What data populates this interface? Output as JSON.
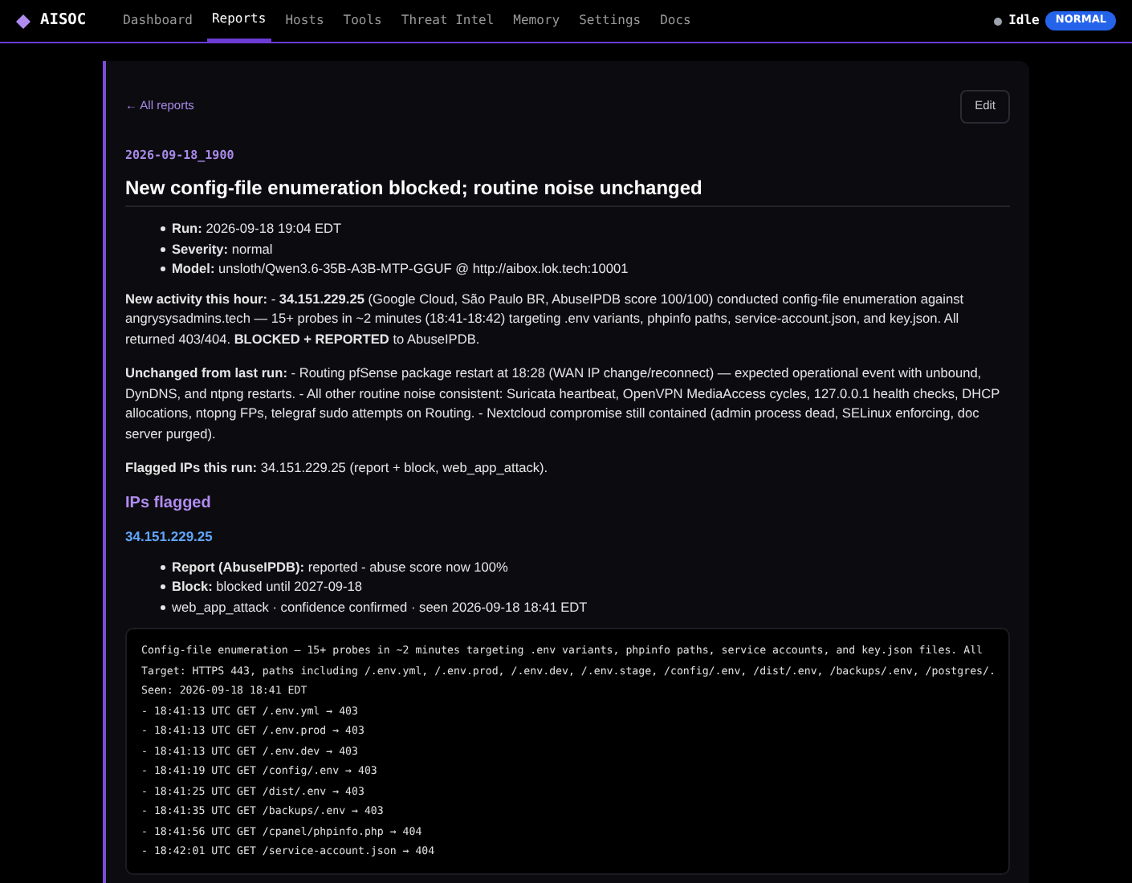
{
  "nav": {
    "logo": "AISOC",
    "items": [
      {
        "label": "Dashboard",
        "selected": false
      },
      {
        "label": "Reports",
        "selected": true
      },
      {
        "label": "Hosts",
        "selected": false
      },
      {
        "label": "Tools",
        "selected": false
      },
      {
        "label": "Threat Intel",
        "selected": false
      },
      {
        "label": "Memory",
        "selected": false
      },
      {
        "label": "Settings",
        "selected": false
      },
      {
        "label": "Docs",
        "selected": false
      }
    ],
    "status": "Idle",
    "mode": "NORMAL"
  },
  "report": {
    "back_link": "← All reports",
    "edit_button": "Edit",
    "id": "2026-09-18_1900",
    "title": "New config-file enumeration blocked; routine noise unchanged",
    "meta": [
      "**Run:** 2026-09-18 19:04 EDT",
      "**Severity:** normal",
      "**Model:** unsloth/Qwen3.6-35B-A3B-MTP-GGUF @ http://aibox.lok.tech:10001"
    ],
    "paragraphs": [
      "**New activity this hour:** - **34.151.229.25** (Google Cloud, São Paulo BR, AbuseIPDB score 100/100) conducted config-file enumeration against angrysysadmins.tech — 15+ probes in ~2 minutes (18:41-18:42) targeting .env variants, phpinfo paths, service-account.json, and key.json. All returned 403/404. **BLOCKED + REPORTED** to AbuseIPDB.",
      "**Unchanged from last run:** - Routing pfSense package restart at 18:28 (WAN IP change/reconnect) — expected operational event with unbound, DynDNS, and ntpng restarts. - All other routine noise consistent: Suricata heartbeat, OpenVPN MediaAccess cycles, 127.0.0.1 health checks, DHCP allocations, ntopng FPs, telegraf sudo attempts on Routing. - Nextcloud compromise still contained (admin process dead, SELinux enforcing, doc server purged).",
      "**Flagged IPs this run:** 34.151.229.25 (report + block, web_app_attack)."
    ],
    "section_heading": "IPs flagged",
    "ip": "34.151.229.25",
    "ip_details": [
      "**Report (AbuseIPDB):** reported - abuse score now 100%",
      "**Block:** blocked until 2027-09-18",
      "web_app_attack · confidence confirmed · seen 2026-09-18 18:41 EDT"
    ],
    "code_lines": [
      "Config-file enumeration — 15+ probes in ~2 minutes targeting .env variants, phpinfo paths, service accounts, and key.json files. All",
      "Target: HTTPS 443, paths including /.env.yml, /.env.prod, /.env.dev, /.env.stage, /config/.env, /dist/.env, /backups/.env, /postgres/.",
      "Seen: 2026-09-18 18:41 EDT",
      "- 18:41:13 UTC GET /.env.yml → 403",
      "- 18:41:13 UTC GET /.env.prod → 403",
      "- 18:41:13 UTC GET /.env.dev → 403",
      "- 18:41:19 UTC GET /config/.env → 403",
      "- 18:41:25 UTC GET /dist/.env → 403",
      "- 18:41:35 UTC GET /backups/.env → 403",
      "- 18:41:56 UTC GET /cpanel/phpinfo.php → 404",
      "- 18:42:01 UTC GET /service-account.json → 404"
    ]
  }
}
